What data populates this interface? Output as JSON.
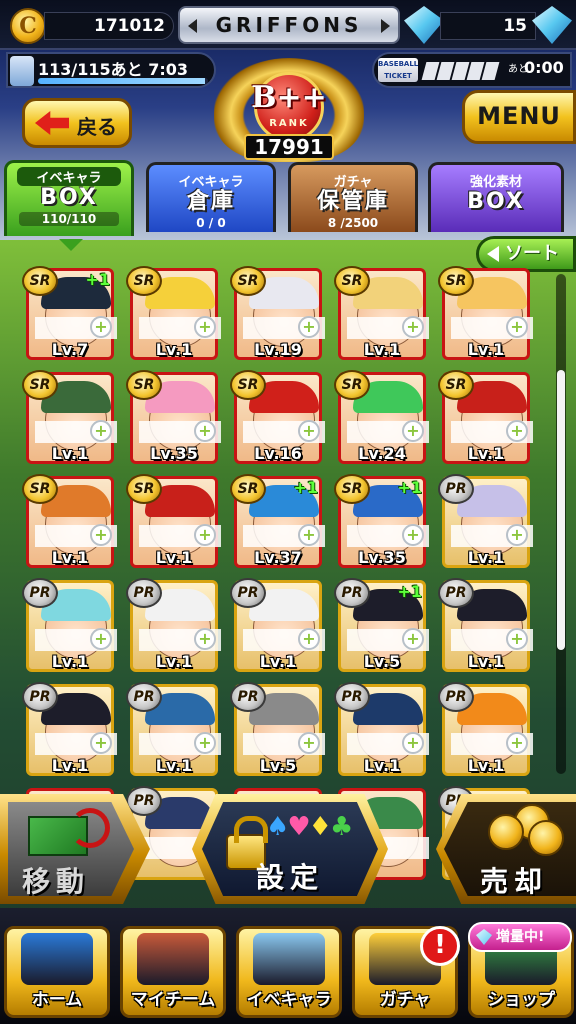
{
  "header": {
    "coins": "171012",
    "coin_icon": "C",
    "team_name": "GRIFFONS",
    "gems": "15",
    "stamina_text": "113/115あと 7:03",
    "stamina_fraction": 0.98,
    "ticket_label": "BASEBALL TICKET",
    "ticket_ato": "あと",
    "ticket_time": "0:00",
    "rank": {
      "value": "B++",
      "label": "RANK",
      "score": "17991"
    },
    "back_label": "戻る",
    "menu_label": "MENU"
  },
  "tabs": [
    {
      "top": "イベキャラ",
      "main": "BOX",
      "count": "110/110"
    },
    {
      "top": "イベキャラ",
      "main": "倉庫",
      "count": "0 / 0"
    },
    {
      "top": "ガチャ",
      "main": "保管庫",
      "count": "8 /2500"
    },
    {
      "top": "強化素材",
      "main": "BOX",
      "count": ""
    }
  ],
  "sort_label": "ソート",
  "cards": [
    {
      "rarity": "SR",
      "level": "Lv.7",
      "plus": "+1",
      "hair": "#1d2a3c"
    },
    {
      "rarity": "SR",
      "level": "Lv.1",
      "plus": "",
      "hair": "#f5d03a"
    },
    {
      "rarity": "SR",
      "level": "Lv.19",
      "plus": "",
      "hair": "#e8e8f0"
    },
    {
      "rarity": "SR",
      "level": "Lv.1",
      "plus": "",
      "hair": "#f2d27a"
    },
    {
      "rarity": "SR",
      "level": "Lv.1",
      "plus": "",
      "hair": "#f6c560"
    },
    {
      "rarity": "SR",
      "level": "Lv.1",
      "plus": "",
      "hair": "#3a6a3a"
    },
    {
      "rarity": "SR",
      "level": "Lv.35",
      "plus": "",
      "hair": "#f59ac0"
    },
    {
      "rarity": "SR",
      "level": "Lv.16",
      "plus": "",
      "hair": "#d0201a"
    },
    {
      "rarity": "SR",
      "level": "Lv.24",
      "plus": "",
      "hair": "#3fc85a"
    },
    {
      "rarity": "SR",
      "level": "Lv.1",
      "plus": "",
      "hair": "#c8201a"
    },
    {
      "rarity": "SR",
      "level": "Lv.1",
      "plus": "",
      "hair": "#e07a2a"
    },
    {
      "rarity": "SR",
      "level": "Lv.1",
      "plus": "",
      "hair": "#c8201a"
    },
    {
      "rarity": "SR",
      "level": "Lv.37",
      "plus": "+1",
      "hair": "#2a8ad8"
    },
    {
      "rarity": "SR",
      "level": "Lv.35",
      "plus": "+1",
      "hair": "#2a6ac8"
    },
    {
      "rarity": "PR",
      "level": "Lv.1",
      "plus": "",
      "hair": "#c6c0e8"
    },
    {
      "rarity": "PR",
      "level": "Lv.1",
      "plus": "",
      "hair": "#7fd8e0"
    },
    {
      "rarity": "PR",
      "level": "Lv.1",
      "plus": "",
      "hair": "#f2f2f2"
    },
    {
      "rarity": "PR",
      "level": "Lv.1",
      "plus": "",
      "hair": "#f2f2f2"
    },
    {
      "rarity": "PR",
      "level": "Lv.5",
      "plus": "+1",
      "hair": "#1d1d2a"
    },
    {
      "rarity": "PR",
      "level": "Lv.1",
      "plus": "",
      "hair": "#1d1d2a"
    },
    {
      "rarity": "PR",
      "level": "Lv.1",
      "plus": "",
      "hair": "#1d1d2a"
    },
    {
      "rarity": "PR",
      "level": "Lv.1",
      "plus": "",
      "hair": "#2a6aa8"
    },
    {
      "rarity": "PR",
      "level": "Lv.5",
      "plus": "",
      "hair": "#8a8a8a"
    },
    {
      "rarity": "PR",
      "level": "Lv.1",
      "plus": "",
      "hair": "#1d3a6a"
    },
    {
      "rarity": "PR",
      "level": "Lv.1",
      "plus": "",
      "hair": "#f28a1a"
    },
    {
      "rarity": "",
      "level": "",
      "plus": "",
      "hair": "#4a3a2a"
    },
    {
      "rarity": "PR",
      "level": "",
      "plus": "",
      "hair": "#2a3a6a"
    },
    {
      "rarity": "",
      "level": "",
      "plus": "",
      "hair": "#4a4a4a"
    },
    {
      "rarity": "",
      "level": "",
      "plus": "",
      "hair": "#3a8a4a"
    },
    {
      "rarity": "PR",
      "level": "",
      "plus": "",
      "hair": "#c8a43a"
    }
  ],
  "actions": {
    "move_label": "移動",
    "set_label": "設定",
    "sell_label": "売却",
    "suits": [
      "♠",
      "♥",
      "♦",
      "♣"
    ]
  },
  "nav": [
    {
      "label": "ホーム",
      "icon": "home-book-icon",
      "color": "#2a7ad8"
    },
    {
      "label": "マイチーム",
      "icon": "team-icon",
      "color": "#c85a3a"
    },
    {
      "label": "イベキャラ",
      "icon": "event-character-icon",
      "color": "#8ac8f0"
    },
    {
      "label": "ガチャ",
      "icon": "gacha-capsule-icon",
      "color": "#ffcf3a"
    },
    {
      "label": "ショップ",
      "icon": "shop-icon",
      "color": "#3aa84a"
    }
  ],
  "nav_badge": "!",
  "nav_promo": "増量中!"
}
